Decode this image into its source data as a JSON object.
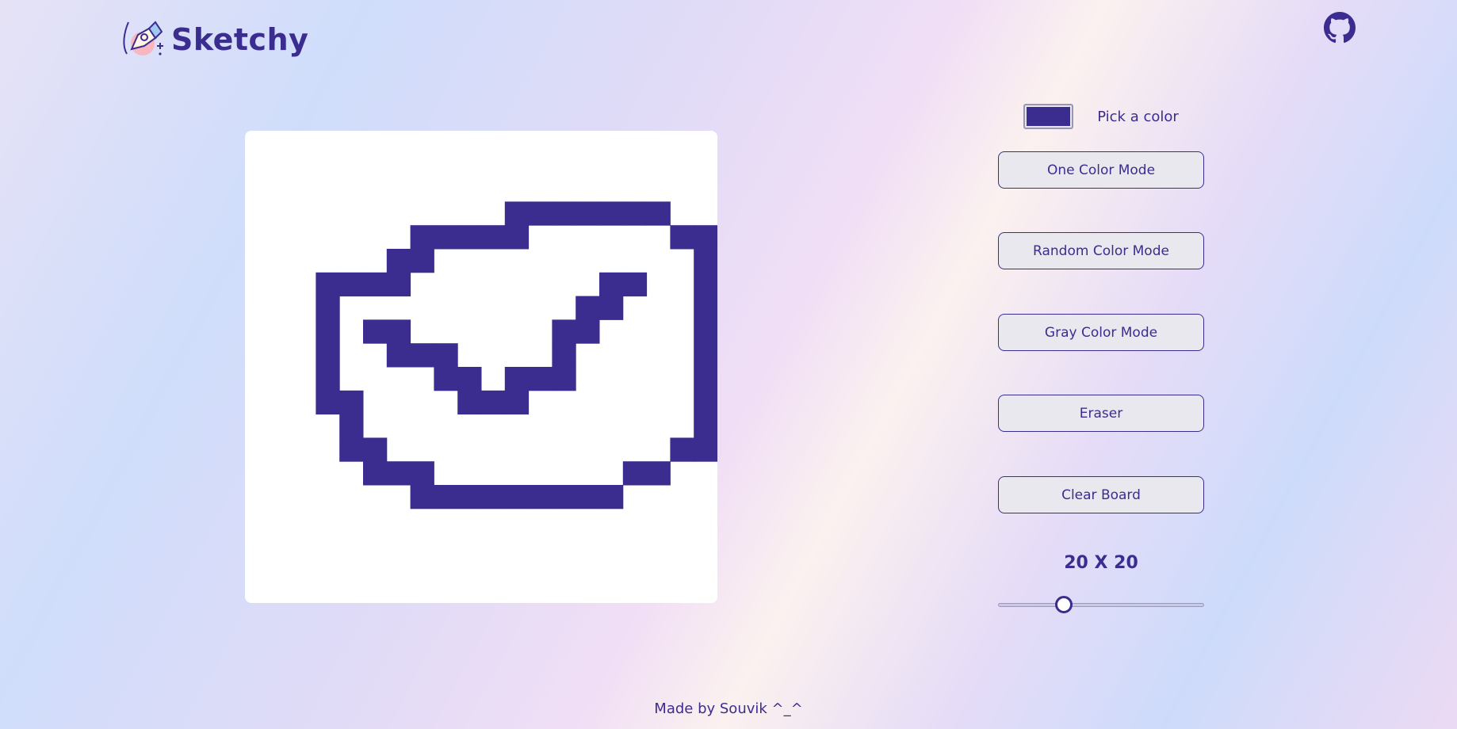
{
  "app": {
    "title": "Sketchy"
  },
  "header": {
    "brand": "Sketchy",
    "logo_icon": "pen-nib-logo-icon",
    "github_icon": "github-icon"
  },
  "controls": {
    "color_picker": {
      "label": "Pick a color",
      "value": "#3b2d8f"
    },
    "buttons": [
      {
        "label": "One Color Mode"
      },
      {
        "label": "Random Color Mode"
      },
      {
        "label": "Gray Color Mode"
      },
      {
        "label": "Eraser"
      },
      {
        "label": "Clear Board"
      }
    ],
    "grid_size_label": "20 X 20",
    "grid_size": {
      "value": 20,
      "min": 1,
      "max": 64
    }
  },
  "board": {
    "grid": 20,
    "fill_color": "#3b2d8f",
    "background": "#ffffff",
    "filled_cells": [
      [
        3,
        11
      ],
      [
        3,
        12
      ],
      [
        3,
        13
      ],
      [
        3,
        14
      ],
      [
        3,
        15
      ],
      [
        3,
        16
      ],
      [
        3,
        17
      ],
      [
        4,
        7
      ],
      [
        4,
        8
      ],
      [
        4,
        9
      ],
      [
        4,
        10
      ],
      [
        4,
        11
      ],
      [
        4,
        18
      ],
      [
        4,
        19
      ],
      [
        5,
        6
      ],
      [
        5,
        7
      ],
      [
        5,
        19
      ],
      [
        6,
        3
      ],
      [
        6,
        4
      ],
      [
        6,
        5
      ],
      [
        6,
        6
      ],
      [
        6,
        15
      ],
      [
        6,
        16
      ],
      [
        6,
        19
      ],
      [
        7,
        3
      ],
      [
        7,
        14
      ],
      [
        7,
        15
      ],
      [
        7,
        19
      ],
      [
        8,
        3
      ],
      [
        8,
        5
      ],
      [
        8,
        6
      ],
      [
        8,
        13
      ],
      [
        8,
        14
      ],
      [
        8,
        19
      ],
      [
        9,
        3
      ],
      [
        9,
        6
      ],
      [
        9,
        7
      ],
      [
        9,
        8
      ],
      [
        9,
        13
      ],
      [
        9,
        19
      ],
      [
        10,
        3
      ],
      [
        10,
        8
      ],
      [
        10,
        9
      ],
      [
        10,
        11
      ],
      [
        10,
        12
      ],
      [
        10,
        13
      ],
      [
        10,
        19
      ],
      [
        11,
        3
      ],
      [
        11,
        4
      ],
      [
        11,
        9
      ],
      [
        11,
        10
      ],
      [
        11,
        11
      ],
      [
        11,
        19
      ],
      [
        12,
        4
      ],
      [
        12,
        19
      ],
      [
        13,
        4
      ],
      [
        13,
        5
      ],
      [
        13,
        18
      ],
      [
        13,
        19
      ],
      [
        14,
        5
      ],
      [
        14,
        6
      ],
      [
        14,
        7
      ],
      [
        14,
        16
      ],
      [
        14,
        17
      ],
      [
        15,
        7
      ],
      [
        15,
        8
      ],
      [
        15,
        9
      ],
      [
        15,
        10
      ],
      [
        15,
        11
      ],
      [
        15,
        12
      ],
      [
        15,
        13
      ],
      [
        15,
        14
      ],
      [
        15,
        15
      ]
    ]
  },
  "footer": {
    "text": "Made by Souvik ^_^"
  }
}
